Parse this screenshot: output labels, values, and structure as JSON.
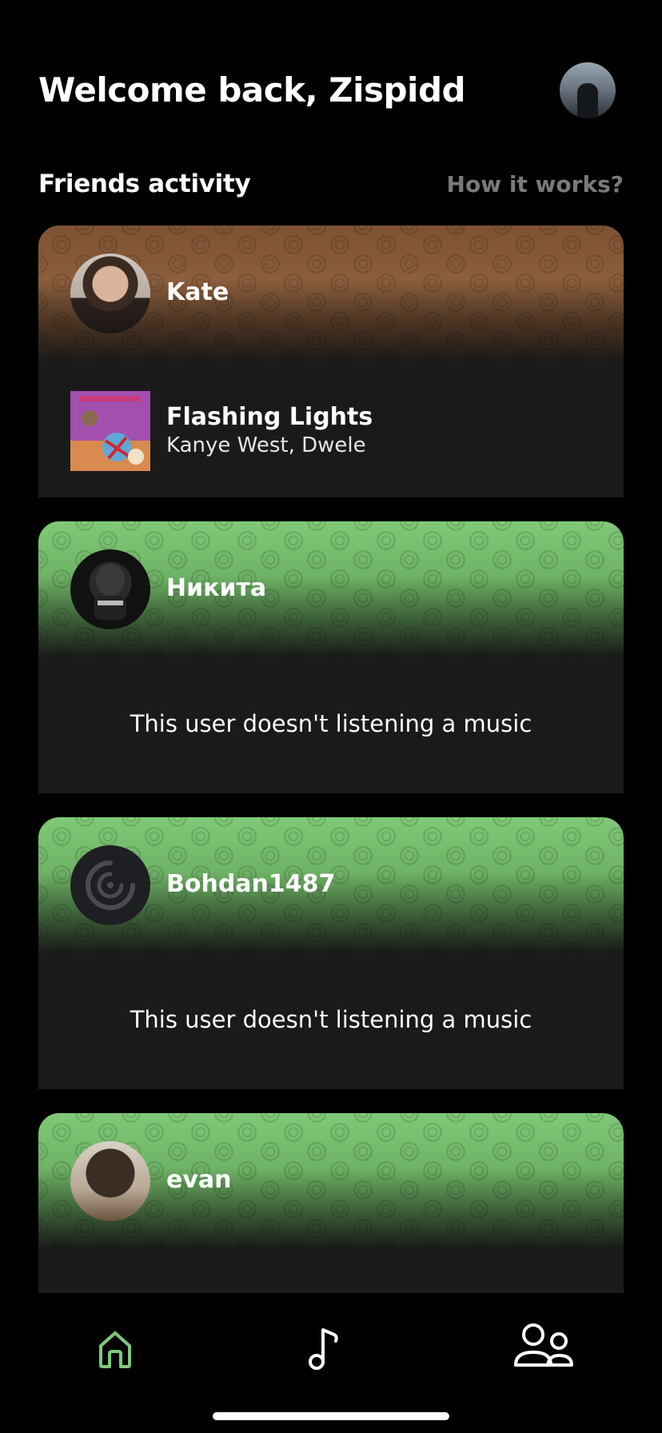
{
  "header": {
    "welcome": "Welcome back, Zispidd",
    "avatar_icon": "profile-avatar"
  },
  "friends": {
    "title": "Friends activity",
    "help_link": "How it works?"
  },
  "colors": {
    "accent_green": "#7ec97a",
    "kate_band": "#8b5e3c",
    "green_band": "#79c46f",
    "card_bg": "#1a1a1a",
    "muted": "#7a7a7a"
  },
  "cards": [
    {
      "name": "Kate",
      "band_color": "#8b5e3c",
      "listening": true,
      "track": {
        "title": "Flashing Lights",
        "artist": "Kanye West, Dwele"
      }
    },
    {
      "name": "Никита",
      "band_color": "#79c46f",
      "listening": false,
      "message": "This user doesn't listening a music"
    },
    {
      "name": "Bohdan1487",
      "band_color": "#79c46f",
      "listening": false,
      "message": "This user doesn't listening a music"
    },
    {
      "name": "evan",
      "band_color": "#79c46f",
      "listening": false
    }
  ],
  "tabbar": {
    "active": "home",
    "tabs": [
      {
        "id": "home",
        "icon": "home-icon"
      },
      {
        "id": "music",
        "icon": "music-note-icon"
      },
      {
        "id": "friends",
        "icon": "friends-icon"
      }
    ]
  }
}
